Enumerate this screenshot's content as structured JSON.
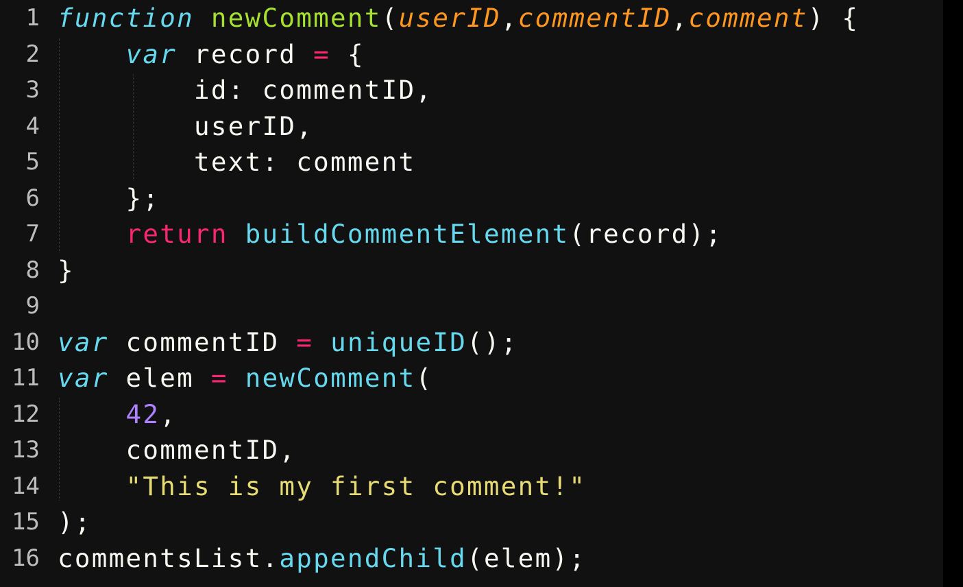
{
  "editor": {
    "theme_colors": {
      "background": "#111111",
      "text": "#f8f8f2",
      "storage": "#66d9ef",
      "function_name": "#a6e22e",
      "parameter": "#fd971f",
      "keyword": "#f92672",
      "number": "#ae81ff",
      "string": "#e6db74",
      "line_number": "#bdbdbd"
    },
    "lines": [
      {
        "number": "1",
        "tokens": [
          "function",
          " ",
          "newComment",
          "(",
          "userID",
          ",",
          "commentID",
          ",",
          "comment",
          ") {"
        ]
      },
      {
        "number": "2",
        "tokens": [
          "    ",
          "var",
          " record ",
          "=",
          " {"
        ]
      },
      {
        "number": "3",
        "tokens": [
          "        id: commentID,"
        ]
      },
      {
        "number": "4",
        "tokens": [
          "        userID,"
        ]
      },
      {
        "number": "5",
        "tokens": [
          "        text: comment"
        ]
      },
      {
        "number": "6",
        "tokens": [
          "    };"
        ]
      },
      {
        "number": "7",
        "tokens": [
          "    ",
          "return",
          " ",
          "buildCommentElement",
          "(record);"
        ]
      },
      {
        "number": "8",
        "tokens": [
          "}"
        ]
      },
      {
        "number": "9",
        "tokens": [
          ""
        ]
      },
      {
        "number": "10",
        "tokens": [
          "var",
          " commentID ",
          "=",
          " ",
          "uniqueID",
          "();"
        ]
      },
      {
        "number": "11",
        "tokens": [
          "var",
          " elem ",
          "=",
          " ",
          "newComment",
          "("
        ]
      },
      {
        "number": "12",
        "tokens": [
          "    ",
          "42",
          ","
        ]
      },
      {
        "number": "13",
        "tokens": [
          "    commentID,"
        ]
      },
      {
        "number": "14",
        "tokens": [
          "    ",
          "\"This is my first comment!\""
        ]
      },
      {
        "number": "15",
        "tokens": [
          ");"
        ]
      },
      {
        "number": "16",
        "tokens": [
          "commentsList.",
          "appendChild",
          "(elem);"
        ]
      }
    ]
  }
}
